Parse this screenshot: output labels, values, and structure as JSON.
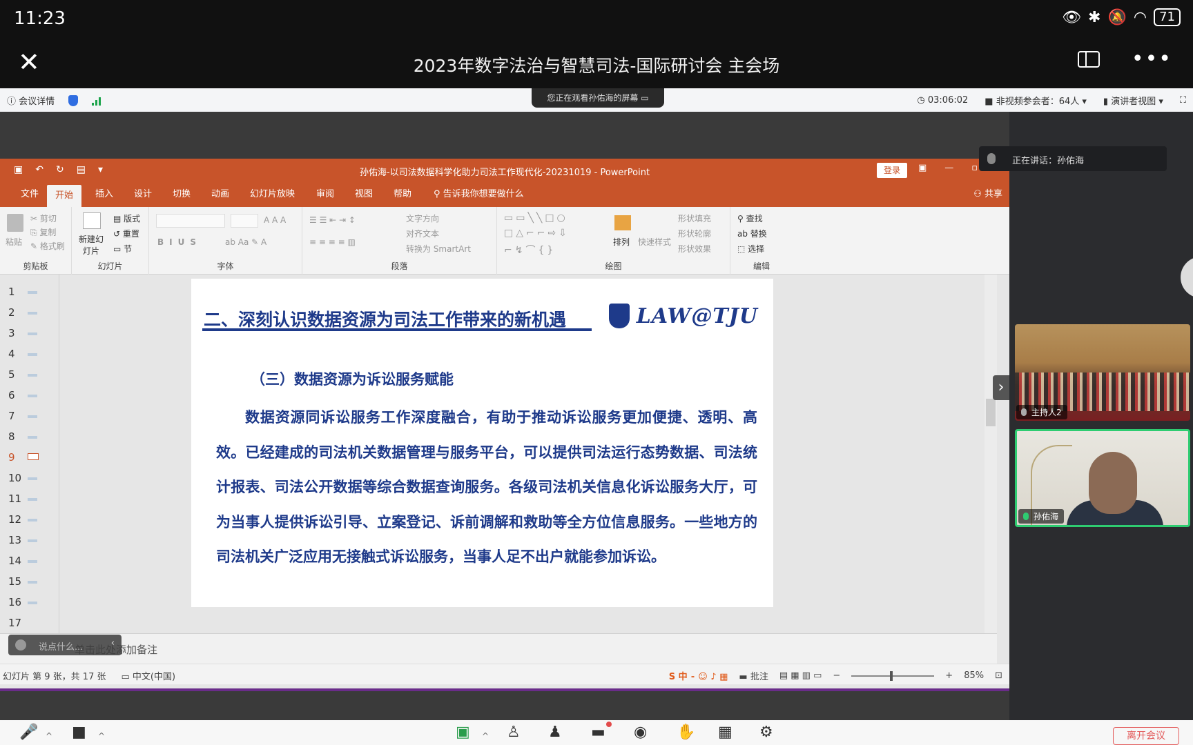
{
  "status_bar": {
    "time": "11:23",
    "battery": "71"
  },
  "app_bar": {
    "title": "2023年数字法治与智慧司法-国际研讨会 主会场"
  },
  "meeting_bar": {
    "details": "会议详情",
    "share_notice": "您正在观看孙佑海的屏幕",
    "elapsed": "03:06:02",
    "non_video_participants": "非视频参会者：64人",
    "view_mode": "演讲者视图"
  },
  "ppt": {
    "window_title": "孙佑海-以司法数据科学化助力司法工作现代化-20231019 - PowerPoint",
    "login": "登录",
    "tabs": [
      "文件",
      "开始",
      "插入",
      "设计",
      "切换",
      "动画",
      "幻灯片放映",
      "审阅",
      "视图",
      "帮助"
    ],
    "active_tab": "开始",
    "tell_me": "告诉我你想要做什么",
    "share": "共享",
    "ribbon": {
      "clipboard": {
        "label": "剪贴板",
        "paste": "粘贴",
        "cut": "剪切",
        "copy": "复制",
        "format_painter": "格式刷"
      },
      "slides": {
        "label": "幻灯片",
        "new_slide": "新建幻灯片",
        "layout": "版式",
        "reset": "重置",
        "section": "节"
      },
      "font": {
        "label": "字体"
      },
      "paragraph": {
        "label": "段落",
        "text_direction": "文字方向",
        "align_text": "对齐文本",
        "convert_smartart": "转换为 SmartArt"
      },
      "drawing": {
        "label": "绘图",
        "arrange": "排列",
        "quick_styles": "快速样式",
        "shape_fill": "形状填充",
        "shape_outline": "形状轮廓",
        "shape_effects": "形状效果"
      },
      "editing": {
        "label": "编辑",
        "find": "查找",
        "replace": "替换",
        "select": "选择"
      }
    },
    "thumbnails": [
      "1",
      "2",
      "3",
      "4",
      "5",
      "6",
      "7",
      "8",
      "9",
      "10",
      "11",
      "12",
      "13",
      "14",
      "15",
      "16",
      "17"
    ],
    "current_slide": 9,
    "slide": {
      "heading": "二、深刻认识数据资源为司法工作带来的新机遇",
      "logo": "LAW@TJU",
      "subheading": "（三）数据资源为诉讼服务赋能",
      "body": "数据资源同诉讼服务工作深度融合，有助于推动诉讼服务更加便捷、透明、高效。已经建成的司法机关数据管理与服务平台，可以提供司法运行态势数据、司法统计报表、司法公开数据等综合数据查询服务。各级司法机关信息化诉讼服务大厅，可为当事人提供诉讼引导、立案登记、诉前调解和救助等全方位信息服务。一些地方的司法机关广泛应用无接触式诉讼服务，当事人足不出户就能参加诉讼。"
    },
    "notes_placeholder": "单击此处添加备注",
    "speech_hint": "说点什么...",
    "status": {
      "slide_info": "幻灯片 第 9 张，共 17 张",
      "language": "中文(中国)",
      "comments": "批注",
      "zoom": "85%"
    }
  },
  "sidebar": {
    "speaking_label": "正在讲话：孙佑海",
    "tiles": [
      {
        "name": "主持人2"
      },
      {
        "name": "孙佑海"
      }
    ]
  },
  "controls": {
    "end_label": "离开会议"
  }
}
